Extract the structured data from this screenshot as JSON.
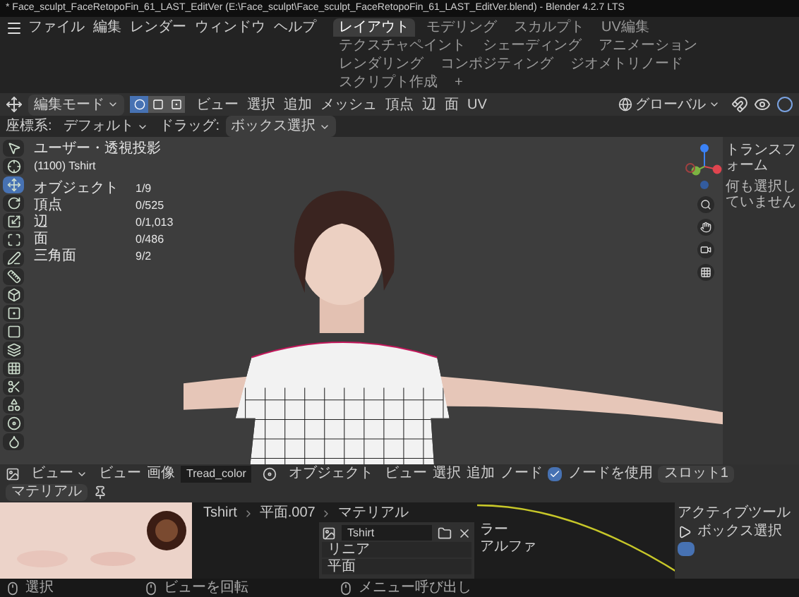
{
  "window": {
    "title": "* Face_sculpt_FaceRetopoFin_61_LAST_EditVer (E:\\Face_sculpt\\Face_sculpt_FaceRetopoFin_61_LAST_EditVer.blend) - Blender 4.2.7 LTS"
  },
  "menu": [
    "ファイル",
    "編集",
    "レンダー",
    "ウィンドウ",
    "ヘルプ"
  ],
  "workspaces": [
    {
      "label": "レイアウト",
      "selected": true
    },
    {
      "label": "モデリング",
      "selected": false
    },
    {
      "label": "スカルプト",
      "selected": false
    },
    {
      "label": "UV編集",
      "selected": false
    },
    {
      "label": "テクスチャペイント",
      "selected": false
    },
    {
      "label": "シェーディング",
      "selected": false
    },
    {
      "label": "アニメーション",
      "selected": false
    },
    {
      "label": "レンダリング",
      "selected": false
    },
    {
      "label": "コンポジティング",
      "selected": false
    },
    {
      "label": "ジオメトリノード",
      "selected": false
    },
    {
      "label": "スクリプト作成",
      "selected": false
    },
    {
      "label": "+",
      "selected": false
    }
  ],
  "header": {
    "mode": "編集モード",
    "select_modes": [
      {
        "kind": "vertex",
        "selected": true
      },
      {
        "kind": "edge",
        "selected": false
      },
      {
        "kind": "face",
        "selected": false
      }
    ],
    "menus": [
      "ビュー",
      "選択",
      "追加",
      "メッシュ",
      "頂点",
      "辺",
      "面",
      "UV"
    ],
    "orientation": "グローバル"
  },
  "tool_settings": {
    "orientation_label": "座標系:",
    "orientation": "デフォルト",
    "drag_label": "ドラッグ:",
    "drag": "ボックス選択"
  },
  "viewport": {
    "view_name": "ユーザー・透視投影",
    "object_name": "(1100) Tshirt",
    "stats": [
      {
        "label": "オブジェクト",
        "value": "1/9"
      },
      {
        "label": "頂点",
        "value": "0/525"
      },
      {
        "label": "辺",
        "value": "0/1,013"
      },
      {
        "label": "面",
        "value": "0/486"
      },
      {
        "label": "三角面",
        "value": "9/2"
      }
    ],
    "tools": [
      {
        "kind": "cursor",
        "selected": false
      },
      {
        "kind": "target",
        "selected": false
      },
      {
        "kind": "move",
        "selected": true
      },
      {
        "kind": "rotate",
        "selected": false
      },
      {
        "kind": "scale",
        "selected": false
      },
      {
        "kind": "transform",
        "selected": false
      },
      {
        "kind": "annotate",
        "selected": false
      },
      {
        "kind": "measure",
        "selected": false
      },
      {
        "kind": "add",
        "selected": false
      },
      {
        "kind": "extrude",
        "selected": false
      },
      {
        "kind": "inset",
        "selected": false
      },
      {
        "kind": "bevel",
        "selected": false
      },
      {
        "kind": "loopcut",
        "selected": false
      },
      {
        "kind": "knife",
        "selected": false
      },
      {
        "kind": "polybuild",
        "selected": false
      },
      {
        "kind": "spin",
        "selected": false
      },
      {
        "kind": "smooth",
        "selected": false
      }
    ],
    "transform_panel": {
      "title": "トランスフォーム",
      "message": "何も選択していません"
    }
  },
  "image_editor": {
    "view_mode": "ビュー",
    "menus": [
      "ビュー",
      "画像"
    ],
    "image": "Tread_color"
  },
  "node_editor": {
    "mode": "オブジェクト",
    "menus": [
      "ビュー",
      "選択",
      "追加",
      "ノード"
    ],
    "use_nodes": {
      "label": "ノードを使用",
      "checked": true
    },
    "slot": "スロット1",
    "material": "マテリアル",
    "breadcrumb": [
      "Tshirt",
      "平面.007",
      "マテリアル"
    ],
    "node": {
      "image": "Tshirt",
      "interpolation": "リニア",
      "projection": "平面"
    },
    "sockets": [
      "ラー",
      "アルファ"
    ]
  },
  "active_tool": {
    "title": "アクティブツール",
    "tool": "ボックス選択"
  },
  "status_bar": [
    "選択",
    "ビューを回転",
    "メニュー呼び出し"
  ]
}
